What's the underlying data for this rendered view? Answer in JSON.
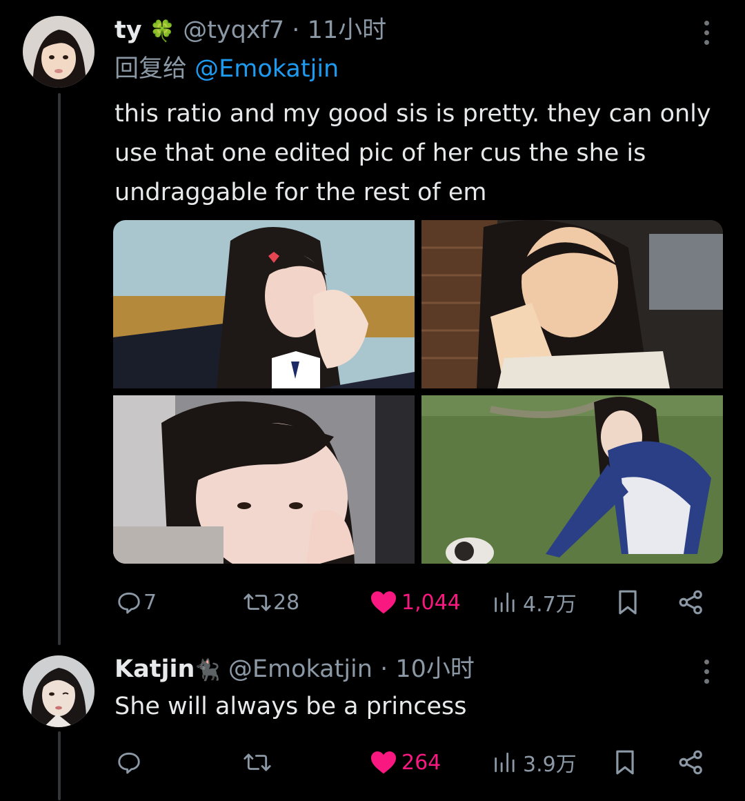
{
  "tweet1": {
    "display_name": "ty",
    "name_emoji": "🍀",
    "handle": "@tyqxf7",
    "separator": "·",
    "time": "11小时",
    "reply_prefix": "回复给",
    "reply_to": "@Emokatjin",
    "text": "this ratio and my good sis is pretty. they can only use that one edited pic of her cus the she is undraggable for the rest of em",
    "media_count": 4,
    "replies": "7",
    "retweets": "28",
    "likes": "1,044",
    "views": "4.7万",
    "liked": true
  },
  "tweet2": {
    "display_name": "Katjin",
    "name_emoji": "🐈‍⬛",
    "handle": "@Emokatjin",
    "separator": "·",
    "time": "10小时",
    "text": "She will always be a princess",
    "replies": "",
    "retweets": "",
    "likes": "264",
    "views": "3.9万",
    "liked": true
  },
  "icons": {
    "reply": "reply-icon",
    "retweet": "retweet-icon",
    "like": "heart-icon",
    "views": "views-icon",
    "bookmark": "bookmark-icon",
    "share": "share-icon",
    "more": "more-icon"
  },
  "colors": {
    "background": "#000000",
    "text": "#e7e9ea",
    "muted": "#8b98a5",
    "link": "#1d9bf0",
    "like": "#f91880"
  }
}
